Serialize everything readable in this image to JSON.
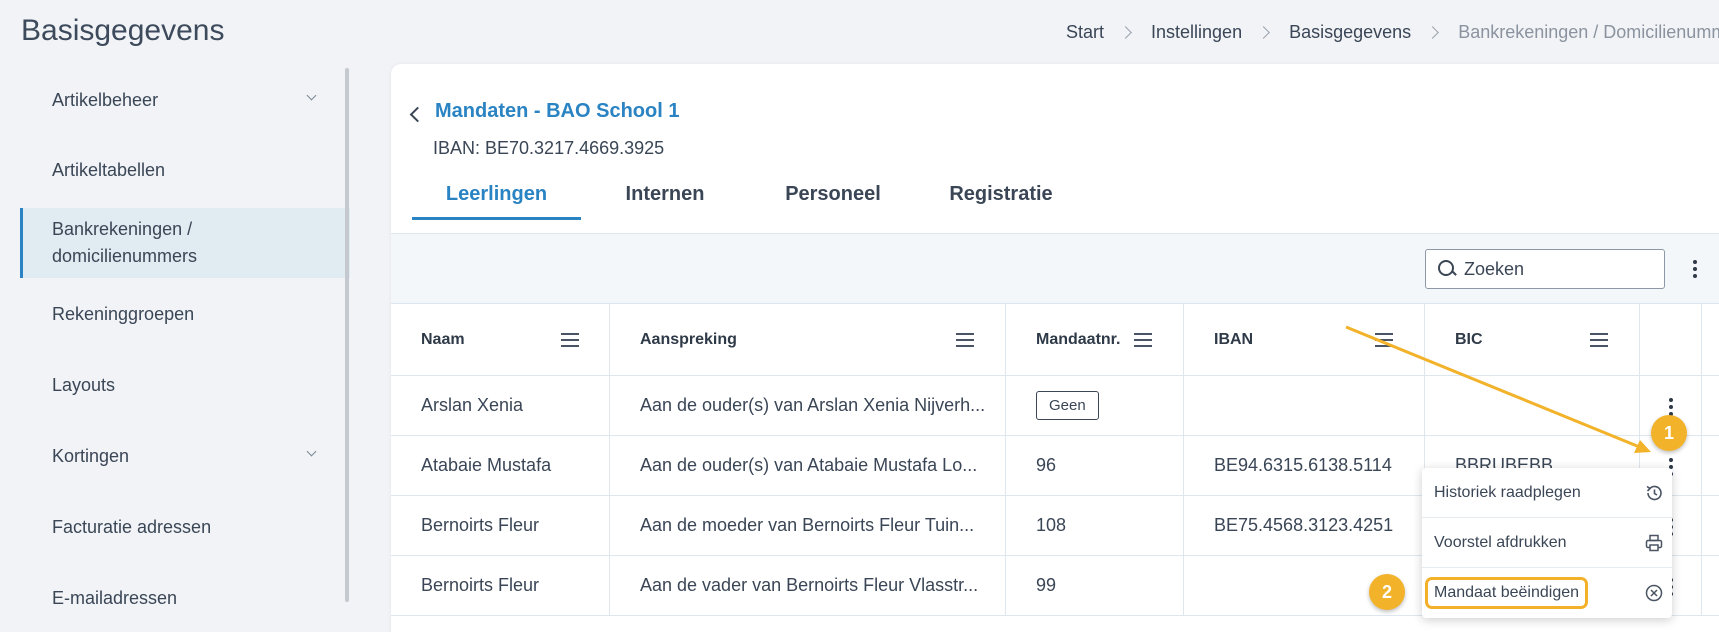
{
  "page": {
    "title": "Basisgegevens"
  },
  "breadcrumb": [
    "Start",
    "Instellingen",
    "Basisgegevens",
    "Bankrekeningen / Domicilienummers"
  ],
  "sidebar": {
    "items": [
      {
        "label": "Artikelbeheer",
        "has_chevron": true
      },
      {
        "label": "Artikeltabellen"
      },
      {
        "label_line1": "Bankrekeningen /",
        "label_line2": "domicilienummers",
        "active": true
      },
      {
        "label": "Rekeninggroepen"
      },
      {
        "label": "Layouts"
      },
      {
        "label": "Kortingen",
        "has_chevron": true
      },
      {
        "label": "Facturatie adressen"
      },
      {
        "label": "E-mailadressen"
      }
    ]
  },
  "mandate": {
    "title": "Mandaten - BAO School 1",
    "iban": "IBAN: BE70.3217.4669.3925"
  },
  "tabs": [
    {
      "label": "Leerlingen",
      "active": true
    },
    {
      "label": "Internen"
    },
    {
      "label": "Personeel"
    },
    {
      "label": "Registratie"
    }
  ],
  "search": {
    "placeholder": "Zoeken"
  },
  "table": {
    "columns": [
      "Naam",
      "Aanspreking",
      "Mandaatnr.",
      "IBAN",
      "BIC"
    ],
    "rows": [
      {
        "naam": "Arslan Xenia",
        "aanspreking": "Aan de ouder(s) van Arslan Xenia Nijverh...",
        "mandaatnr": "Geen",
        "iban": "",
        "bic": ""
      },
      {
        "naam": "Atabaie Mustafa",
        "aanspreking": "Aan de ouder(s) van Atabaie Mustafa Lo...",
        "mandaatnr": "96",
        "iban": "BE94.6315.6138.5114",
        "bic": "BBRUBEBB"
      },
      {
        "naam": "Bernoirts Fleur",
        "aanspreking": "Aan de moeder van Bernoirts Fleur Tuin...",
        "mandaatnr": "108",
        "iban": "BE75.4568.3123.4251",
        "bic": ""
      },
      {
        "naam": "Bernoirts Fleur",
        "aanspreking": "Aan de vader van Bernoirts Fleur Vlasstr...",
        "mandaatnr": "99",
        "iban": "",
        "bic": ""
      }
    ]
  },
  "row_menu": {
    "items": [
      {
        "label": "Historiek raadplegen",
        "icon": "history-icon"
      },
      {
        "label": "Voorstel afdrukken",
        "icon": "printer-icon"
      },
      {
        "label": "Mandaat beëindigen",
        "icon": "close-circle-icon",
        "highlighted": true
      }
    ]
  },
  "annotations": {
    "step1": "1",
    "step2": "2"
  },
  "colors": {
    "accent": "#2a83c2",
    "marker": "#f2b22a",
    "sidebar_active_bg": "#e1ebf2"
  }
}
